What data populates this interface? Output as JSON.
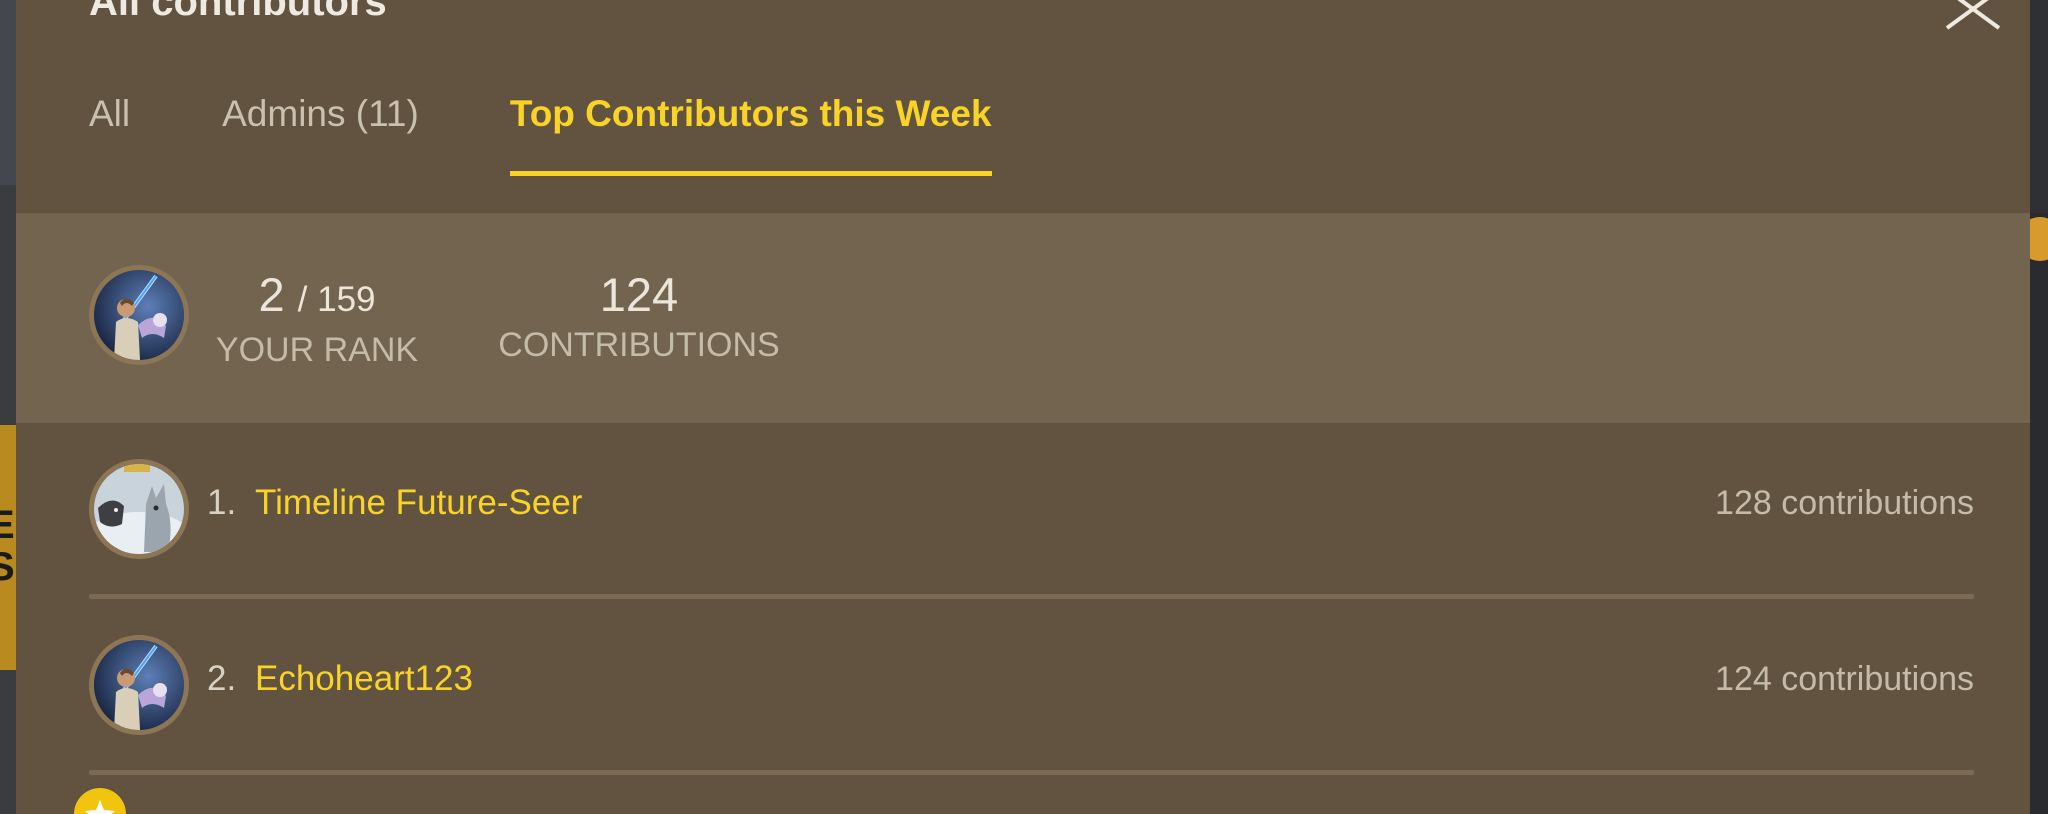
{
  "modal": {
    "title": "All contributors"
  },
  "tabs": [
    {
      "label": "All",
      "active": false
    },
    {
      "label": "Admins (11)",
      "active": false
    },
    {
      "label": "Top Contributors this Week",
      "active": true
    }
  ],
  "your_stats": {
    "rank": "2",
    "rank_total": "/ 159",
    "rank_label": "YOUR RANK",
    "contributions": "124",
    "contributions_label": "CONTRIBUTIONS"
  },
  "leaderboard": [
    {
      "rank": "1.",
      "name": "Timeline Future-Seer",
      "contributions": "128 contributions",
      "avatar": "wolf-avatar"
    },
    {
      "rank": "2.",
      "name": "Echoheart123",
      "contributions": "124 contributions",
      "avatar": "jedi-avatar"
    }
  ],
  "colors": {
    "modal_bg": "#625340",
    "panel_bg": "#73644f",
    "accent": "#f9d426",
    "muted_text": "#c4bba9"
  }
}
